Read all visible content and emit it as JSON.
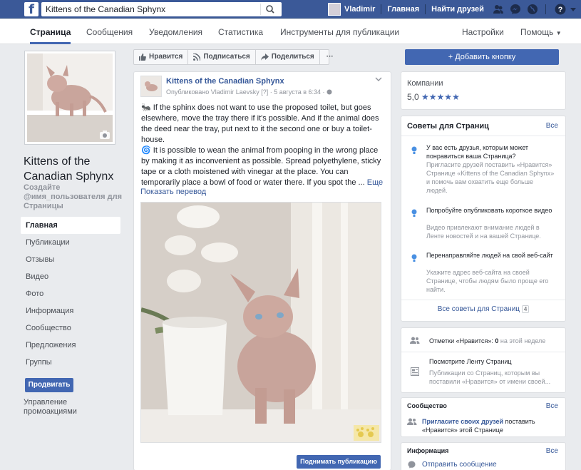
{
  "topbar": {
    "search_value": "Kittens of the Canadian Sphynx",
    "user_name": "Vladimir",
    "home": "Главная",
    "find_friends": "Найти друзей"
  },
  "subnav": {
    "tabs": [
      "Страница",
      "Сообщения",
      "Уведомления",
      "Статистика",
      "Инструменты для публикации"
    ],
    "settings": "Настройки",
    "help": "Помощь"
  },
  "left": {
    "page_name": "Kittens of the Canadian Sphynx",
    "create_username": "Создайте @имя_пользователя для Страницы",
    "menu": [
      "Главная",
      "Публикации",
      "Отзывы",
      "Видео",
      "Фото",
      "Информация",
      "Сообщество",
      "Предложения",
      "Группы"
    ],
    "promote": "Продвигать",
    "manage_promos": "Управление промоакциями"
  },
  "actions": {
    "like": "Нравится",
    "follow": "Подписаться",
    "share": "Поделиться",
    "more": "···",
    "add_button": "Добавить кнопку"
  },
  "post": {
    "page": "Kittens of the Canadian Sphynx",
    "meta": "Опубликовано Vladimir Laevsky [?] · 5 августа в 6:34 ·",
    "para1": "If the sphinx does not want to use the proposed toilet, but goes elsewhere, move the tray there if it's possible. And if the animal does the deed near the tray, put next to it the second one or buy a toilet-house.",
    "para2": "It is possible to wean the animal from pooping in the wrong place by making it as inconvenient as possible. Spread polyethylene, sticky tape or a cloth moistened with vinegar at the place. You can temporarily place a bowl of food or water there. If you spot the ...",
    "more": "Еще",
    "translate": "Показать перевод",
    "boost": "Поднимать публикацию"
  },
  "right": {
    "category": "Компании",
    "rating": "5,0",
    "tips_title": "Советы для Страниц",
    "tips_all": "Все",
    "tips": [
      {
        "title": "У вас есть друзья, которым может понравиться ваша Страница?",
        "desc": "Пригласите друзей поставить «Нравится» Странице «Kittens of the Canadian Sphynx» и помочь вам охватить еще больше людей."
      },
      {
        "title": "Попробуйте опубликовать короткое видео",
        "desc": "Видео привлекают внимание людей в Ленте новостей и на вашей Странице."
      },
      {
        "title": "Перенаправляйте людей на свой веб-сайт",
        "desc": "Укажите адрес веб-сайта на своей Странице, чтобы людям было проще его найти."
      }
    ],
    "all_tips": "Все советы для Страниц",
    "all_tips_count": "4",
    "likes_prefix": "Отметки «Нравится»:",
    "likes_count": "0",
    "likes_suffix": "на этой неделе",
    "feed_title": "Посмотрите Ленту Страниц",
    "feed_desc": "Публикации со Страниц, которым вы поставили «Нравится» от имени своей...",
    "community_title": "Сообщество",
    "community_all": "Все",
    "invite_link": "Пригласите своих друзей",
    "invite_rest": "поставить «Нравится» этой Странице",
    "info_title": "Информация",
    "info_all": "Все",
    "send_message": "Отправить сообщение"
  },
  "colors": {
    "brand": "#3b5998",
    "button": "#4267b2",
    "link": "#365899"
  }
}
